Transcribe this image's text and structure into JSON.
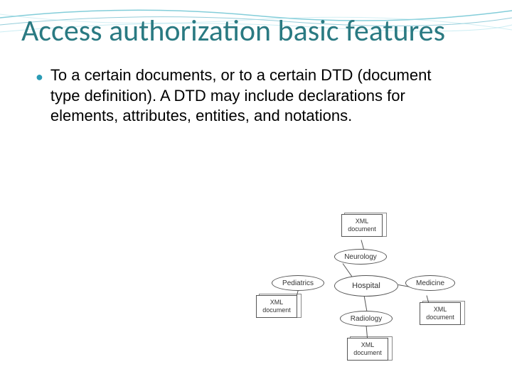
{
  "title": "Access authorization basic features",
  "bullet1": "To a certain documents, or to a certain DTD (document type definition). A DTD may include declarations for elements, attributes, entities, and notations.",
  "diagram": {
    "doc_label": "XML document",
    "center": "Hospital",
    "node_top": "Neurology",
    "node_left": "Pediatrics",
    "node_right": "Medicine",
    "node_bottom": "Radiology"
  }
}
